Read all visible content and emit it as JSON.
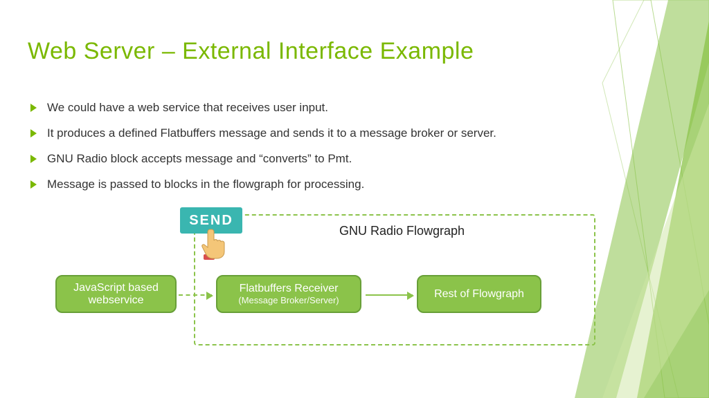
{
  "title": "Web Server – External Interface Example",
  "bullets": [
    "We could have a web service that receives user input.",
    "It produces a defined Flatbuffers message and sends it to a message broker or server.",
    "GNU Radio block accepts message and “converts” to Pmt.",
    "Message is passed to blocks in the flowgraph for processing."
  ],
  "diagram": {
    "send_label": "SEND",
    "flowgraph_label": "GNU Radio Flowgraph",
    "node1_line1": "JavaScript based",
    "node1_line2": "webservice",
    "node2_line1": "Flatbuffers Receiver",
    "node2_line2": "(Message Broker/Server)",
    "node3": "Rest of Flowgraph"
  },
  "colors": {
    "accent": "#8bc34a",
    "accent_dark": "#689f38",
    "title": "#7ab800",
    "send": "#3ab6b0"
  }
}
